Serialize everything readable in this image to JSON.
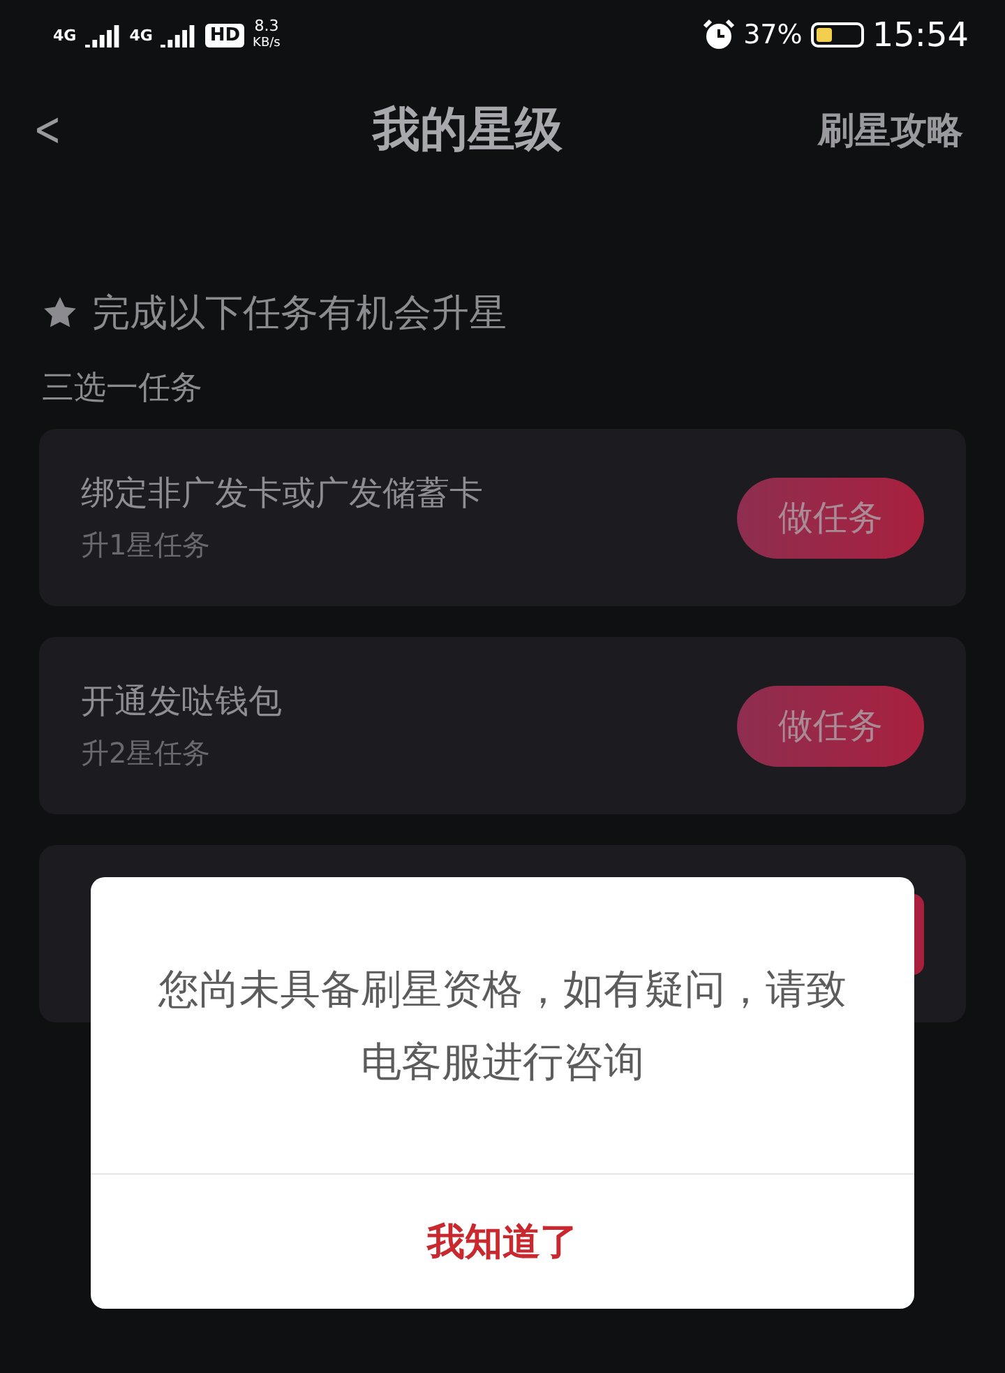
{
  "status_bar": {
    "network_1": "4G",
    "network_2": "4G",
    "hd": "HD",
    "speed": "8.3",
    "speed_unit": "KB/s",
    "battery_percent": "37%",
    "time": "15:54"
  },
  "header": {
    "back": "<",
    "title": "我的星级",
    "action": "刷星攻略"
  },
  "section": {
    "heading": "完成以下任务有机会升星",
    "subheading": "三选一任务"
  },
  "tasks": [
    {
      "title": "绑定非广发卡或广发储蓄卡",
      "reward": "升1星任务",
      "button": "做任务"
    },
    {
      "title": "开通发哒钱包",
      "reward": "升2星任务",
      "button": "做任务"
    }
  ],
  "dialog": {
    "message": "您尚未具备刷星资格，如有疑问，请致电客服进行咨询",
    "button": "我知道了"
  }
}
